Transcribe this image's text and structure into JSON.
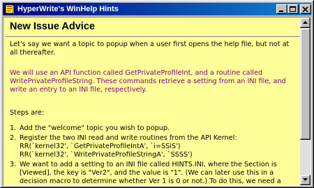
{
  "window": {
    "title": "HyperWrite's WinHelp Hints",
    "controls": {
      "minimize": "minimize-icon",
      "maximize": "maximize-icon",
      "close": "close-icon"
    }
  },
  "content": {
    "heading": "New Issue Advice",
    "paragraph1": "Let's say we want a topic to popup when a user first opens the help file, but not at all thereafter.",
    "paragraph2": "We will use an API function called GetPrivateProfileInt, and a routine called WritePrivateProfileString. These commands retrieve a setting from an INI file, and write an entry to an INI file, respectively.",
    "paragraph3": "Steps are:",
    "steps": [
      {
        "num": "1.",
        "lines": [
          "Add the \"welcome\" topic you wish to popup."
        ]
      },
      {
        "num": "2.",
        "lines": [
          "Register the two INI read and write routines from the API Kernel:",
          "RR(`kernel32', `GetPrivateProfileIntA', `i=SSiS')",
          "RR(`kernel32', `WritePrivateProfileStringA', `SSSS')"
        ]
      },
      {
        "num": "3.",
        "lines": [
          "We want to add a setting to an INI file called HINTS.INI, where the Section is",
          "[Viewed], the key is \"Ver2\", and the value is \"1\". (We can later use this in a",
          "decision macro to determine whether Ver 1 is 0 or not.) To do this, we need a"
        ]
      }
    ]
  },
  "colors": {
    "titlebar_start": "#000080",
    "titlebar_end": "#1084d0",
    "background": "#ffff99",
    "accent_text": "#800080"
  },
  "scrollbar": {
    "up_icon": "scroll-up-arrow-icon",
    "down_icon": "scroll-down-arrow-icon"
  }
}
